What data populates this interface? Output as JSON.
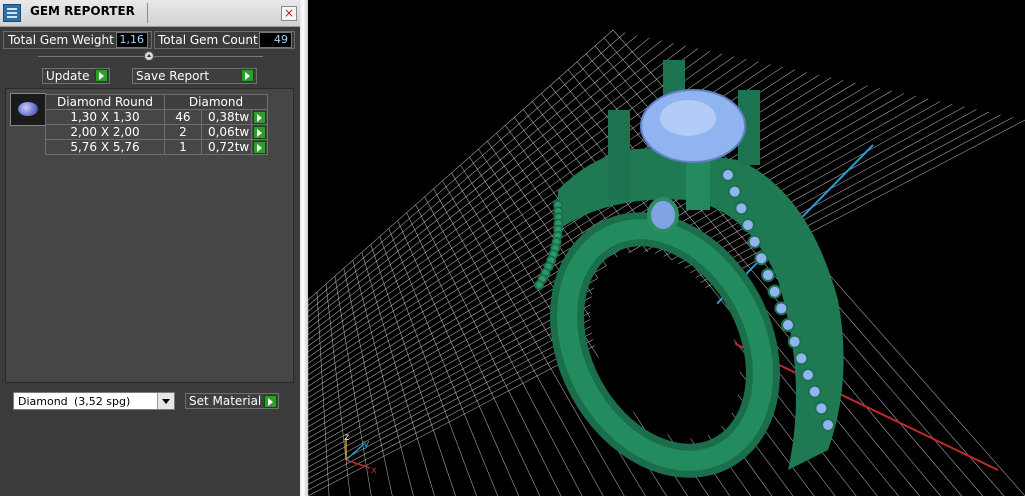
{
  "window": {
    "title": "GEM REPORTER",
    "close_glyph": "×"
  },
  "summary": {
    "total_weight_label": "Total Gem Weight",
    "total_weight_value": "1,16",
    "total_count_label": "Total Gem Count",
    "total_count_value": "49"
  },
  "actions": {
    "update_label": "Update",
    "save_report_label": "Save Report"
  },
  "table": {
    "headers": [
      "Diamond Round",
      "Diamond"
    ],
    "rows": [
      {
        "size": "1,30 X 1,30",
        "count": "46",
        "weight": "0,38tw"
      },
      {
        "size": "2,00 X 2,00",
        "count": "2",
        "weight": "0,06tw"
      },
      {
        "size": "5,76 X 5,76",
        "count": "1",
        "weight": "0,72tw"
      }
    ]
  },
  "material": {
    "selected_name": "Diamond",
    "selected_value": "(3,52 spg)",
    "set_label": "Set Material"
  },
  "viewport": {
    "axis_labels": {
      "z": "z",
      "y": "y",
      "x": "x"
    },
    "colors": {
      "metal": "#1f7a54",
      "gem": "#8fb4f0",
      "grid": "#d8d8d8",
      "x_axis": "#c0282d",
      "y_axis": "#2d9ad0"
    }
  },
  "icons": {
    "app": "gem-reporter-icon",
    "close": "close-icon",
    "thumb": "gem-thumbnail-icon",
    "run": "play-arrow-icon",
    "dropdown": "chevron-down-icon"
  }
}
